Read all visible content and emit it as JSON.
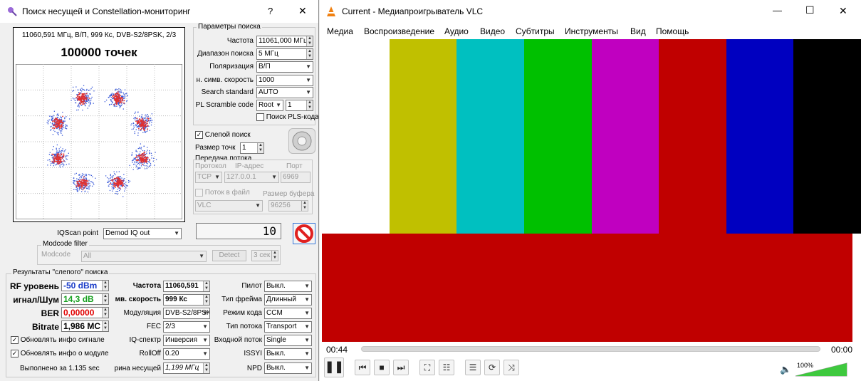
{
  "search_window": {
    "title": "Поиск несущей и Constellation-мониторинг",
    "help_glyph": "?",
    "close_glyph": "✕",
    "constellation": {
      "info_line": "11060,591 МГц, В/П, 999 Кс, DVB-S2/8PSK, 2/3",
      "points_label": "100000 точек"
    },
    "search_params": {
      "group_label": "Параметры поиска",
      "frequency_label": "Частота",
      "frequency_value": "11061,000 МГц",
      "range_label": "Диапазон поиска",
      "range_value": "5 МГц",
      "polarization_label": "Поляризация",
      "polarization_value": "В/П",
      "symrate_label": "н. симв. скорость",
      "symrate_value": "1000",
      "standard_label": "Search standard",
      "standard_value": "AUTO",
      "scramble_label": "PL Scramble code",
      "scramble_mode": "Root",
      "scramble_value": "1",
      "pls_label": "Поиск PLS-кода"
    },
    "blind": {
      "label": "Слепой поиск",
      "checked": true,
      "point_size_label": "Размер точк",
      "point_size_value": "1"
    },
    "stream": {
      "group_label": "Передача потока",
      "protocol_label": "Протокол",
      "ip_label": "IP-адрес",
      "port_label": "Порт",
      "protocol_value": "TCP",
      "ip_value": "127.0.0.1",
      "port_value": "6969",
      "file_label": "Поток в файл",
      "buffer_label": "Размер буфера",
      "player_value": "VLC",
      "buffer_value": "96256"
    },
    "iqscan_label": "IQScan point",
    "iqscan_value": "Demod IQ out",
    "counter_value": "10",
    "modcode": {
      "group_label": "Modcode filter",
      "label": "Modcode",
      "value": "All",
      "detect_label": "Detect",
      "time_value": "3 сек"
    },
    "results": {
      "group_label": "Результаты \"слепого\" поиска",
      "rf_label": "RF уровень",
      "rf_value": "-50 dBm",
      "snr_label": "игнал/Шум",
      "snr_value": "14,3 dB",
      "ber_label": "BER",
      "ber_value": "0,00000",
      "bitrate_label": "Bitrate",
      "bitrate_value": "1,986 МС",
      "freq_label": "Частота",
      "freq_value": "11060,591",
      "symrate_label": "мв. скорость",
      "symrate_value": "999 Кс",
      "modulation_label": "Модуляция",
      "modulation_value": "DVB-S2/8PSK",
      "fec_label": "FEC",
      "fec_value": "2/3",
      "iq_label": "IQ-спектр",
      "iq_value": "Инверсия",
      "rolloff_label": "RollOff",
      "rolloff_value": "0.20",
      "carrier_width_label": "рина несущей",
      "carrier_width_value": "1,199 МГц",
      "pilot_label": "Пилот",
      "pilot_value": "Выкл.",
      "frame_label": "Тип фрейма",
      "frame_value": "Длинный",
      "code_mode_label": "Режим кода",
      "code_mode_value": "CCM",
      "stream_type_label": "Тип потока",
      "stream_type_value": "Transport",
      "input_stream_label": "Входной поток",
      "input_stream_value": "Single",
      "issyi_label": "ISSYI",
      "issyi_value": "Выкл.",
      "npd_label": "NPD",
      "npd_value": "Выкл.",
      "update_signal_label": "Обновлять инфо сигнале",
      "update_module_label": "Обновлять инфо о модуле",
      "elapsed_label": "Выполнено за 1.135 sec"
    }
  },
  "vlc": {
    "title": "Current - Медиапроигрыватель VLC",
    "window_controls": {
      "minimize": "—",
      "maximize": "☐",
      "close": "✕"
    },
    "menu": [
      "Медиа",
      "Воспроизведение",
      "Аудио",
      "Видео",
      "Субтитры",
      "Инструменты",
      "Вид",
      "Помощь"
    ],
    "time_elapsed": "00:44",
    "time_total": "00:00",
    "seek_fraction": 0,
    "volume_label": "100%",
    "volume_fraction": 1.0,
    "test_pattern_colors": [
      "#ffffff",
      "#c0c000",
      "#00c0c0",
      "#00c000",
      "#c000c0",
      "#c00000",
      "#0000c0",
      "#000000"
    ],
    "lower_color": "#c00000"
  },
  "colors": {
    "rf_value": "#1a3cc8",
    "snr_value": "#17a020",
    "ber_value": "#e00000",
    "vlc_orange": "#f08010",
    "volume_green": "#3ec93e"
  }
}
